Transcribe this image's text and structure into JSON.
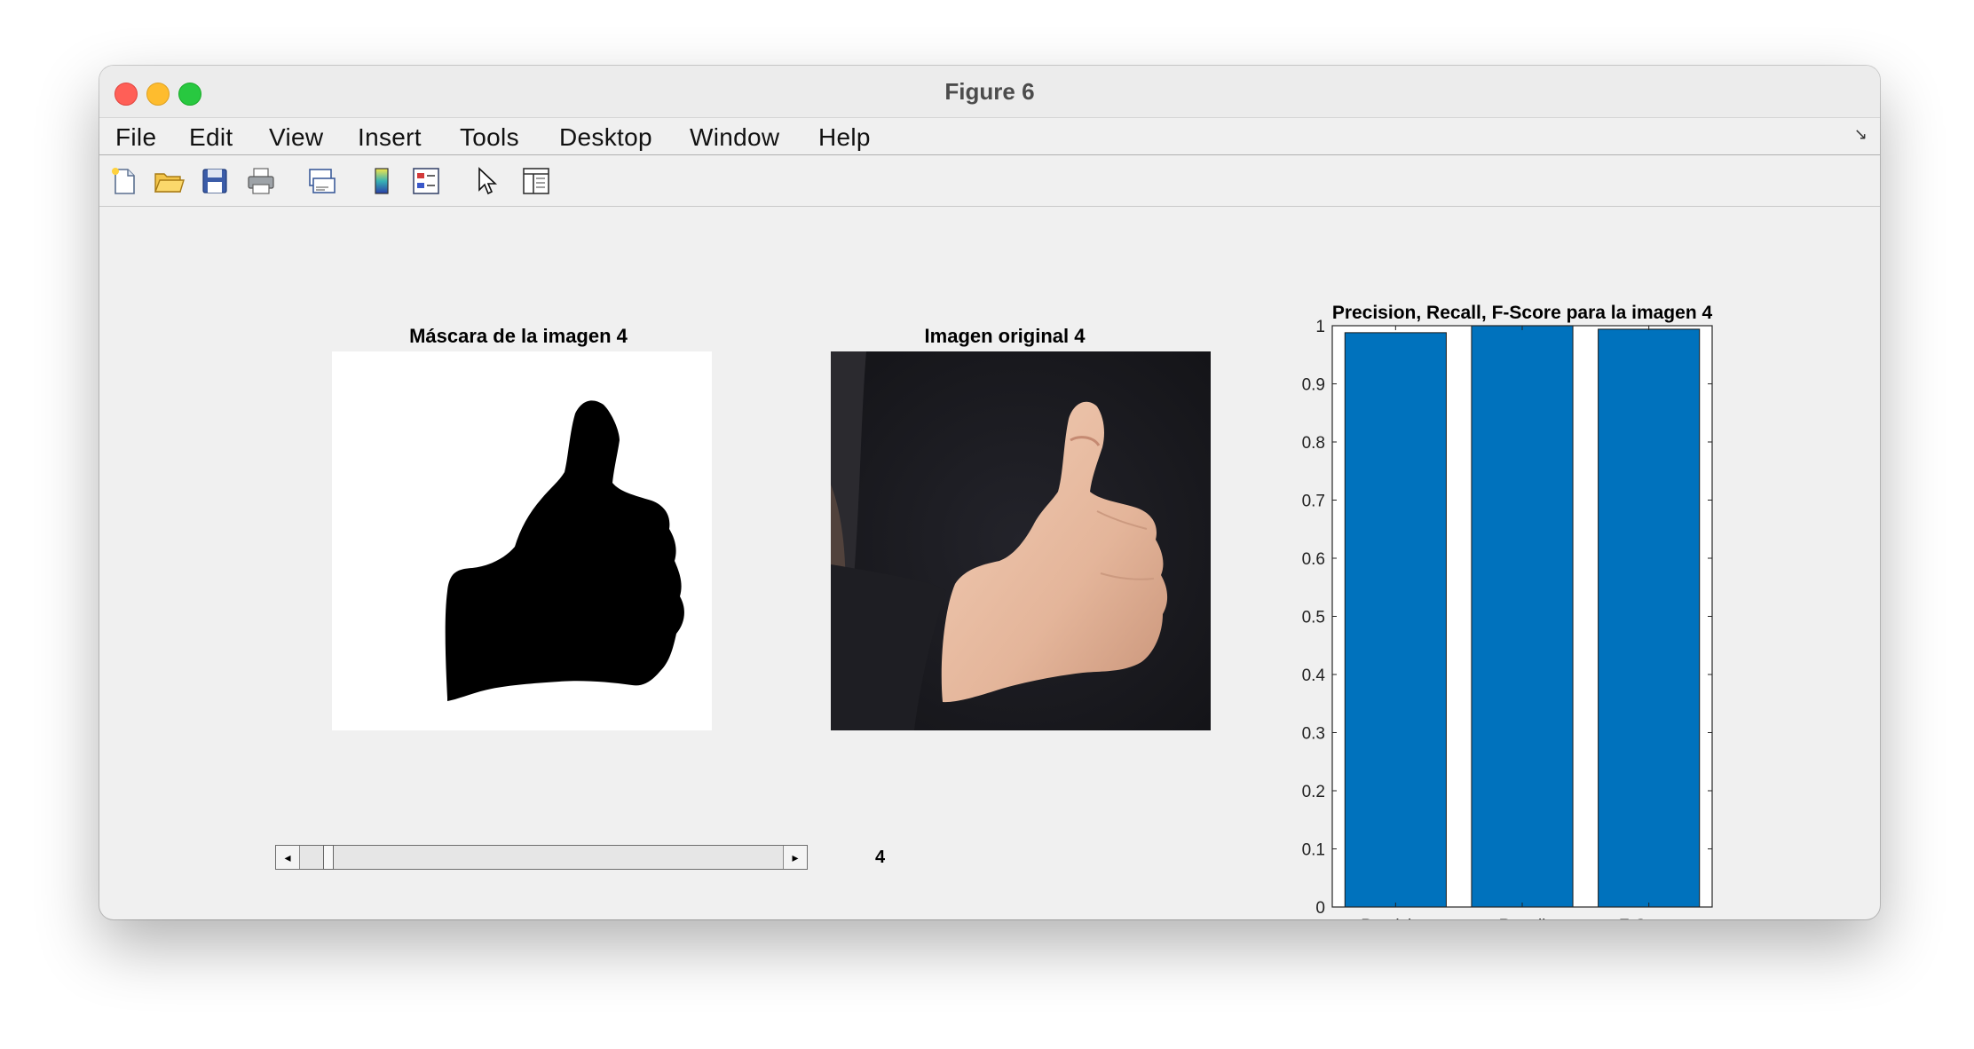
{
  "window": {
    "title": "Figure 6"
  },
  "menu": [
    "File",
    "Edit",
    "View",
    "Insert",
    "Tools",
    "Desktop",
    "Window",
    "Help"
  ],
  "toolbar": [
    {
      "icon": "new-figure-icon"
    },
    {
      "icon": "open-folder-icon"
    },
    {
      "icon": "save-icon"
    },
    {
      "icon": "print-icon"
    },
    {
      "icon": "link-plot-icon"
    },
    {
      "icon": "insert-colorbar-icon"
    },
    {
      "icon": "insert-legend-icon"
    },
    {
      "icon": "edit-plot-arrow-icon"
    },
    {
      "icon": "property-inspector-icon"
    }
  ],
  "mask_axes": {
    "title": "Máscara de la imagen 4"
  },
  "original_axes": {
    "title": "Imagen original 4"
  },
  "slider": {
    "value": 4,
    "position_fraction": 0.05,
    "label": "4"
  },
  "chart_data": {
    "type": "bar",
    "title": "Precision, Recall, F-Score para la imagen 4",
    "categories": [
      "Precision",
      "Recall",
      "F-Score"
    ],
    "values": [
      0.988,
      1.0,
      0.994
    ],
    "ylim": [
      0,
      1
    ],
    "yticks": [
      "0",
      "0.1",
      "0.2",
      "0.3",
      "0.4",
      "0.5",
      "0.6",
      "0.7",
      "0.8",
      "0.9",
      "1"
    ],
    "bar_color": "#0072BD",
    "grid": false,
    "xlabel": "",
    "ylabel": ""
  }
}
